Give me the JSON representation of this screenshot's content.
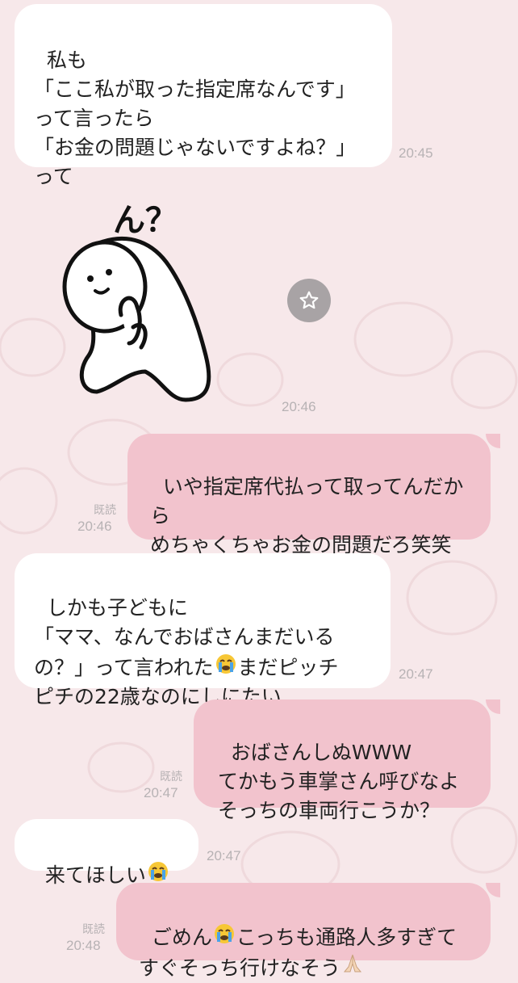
{
  "messages": [
    {
      "text": "私も\n「ここ私が取った指定席なんです」\nって言ったら\n「お金の問題じゃないですよね？」\nって",
      "time": "20:45"
    },
    {
      "sticker_text": "ん？",
      "time": "20:46"
    },
    {
      "text": "いや指定席代払って取ってんだか\nら\nめちゃくちゃお金の問題だろ笑笑",
      "read": "既読",
      "time": "20:46"
    },
    {
      "text_a": "しかも子どもに\n「ママ、なんでおばさんまだいる\nの？」って言われた",
      "text_b": "まだピッチ\nピチの22歳なのにしにたい",
      "time": "20:47"
    },
    {
      "text": "おばさんしぬWWW\nてかもう車掌さん呼びなよ\nそっちの車両行こうか？",
      "read": "既読",
      "time": "20:47"
    },
    {
      "text": "来てほしい",
      "time": "20:47"
    },
    {
      "text_a": "ごめん",
      "text_b": "こっちも通路人多すぎて\nすぐそっち行けなそう",
      "read": "既読",
      "time": "20:48"
    }
  ],
  "icons": {
    "star": "star-icon",
    "crying": "crying-face-emoji",
    "pray": "folded-hands-emoji"
  }
}
